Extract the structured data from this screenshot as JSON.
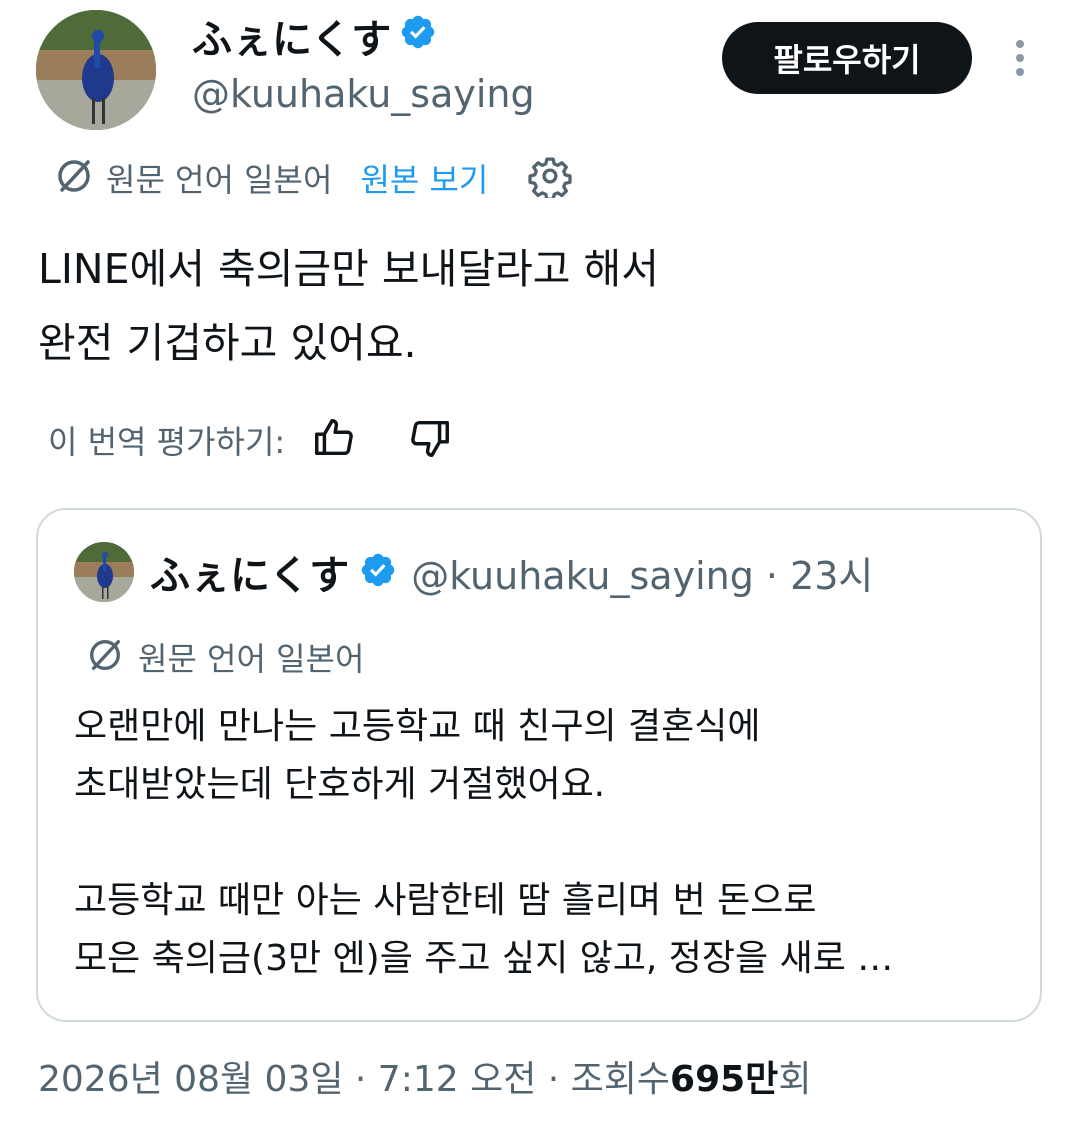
{
  "author": {
    "display_name": "ふぇにくす",
    "handle": "@kuuhaku_saying",
    "verified": true
  },
  "follow_button_label": "팔로우하기",
  "translation": {
    "source_label": "원문 언어 일본어",
    "view_original_label": "원본 보기"
  },
  "tweet_text_lines": [
    "LINE에서 축의금만 보내달라고 해서",
    "완전 기겁하고 있어요."
  ],
  "rate_translation_label": "이 번역 평가하기:",
  "quoted_tweet": {
    "display_name": "ふぇにくす",
    "handle_time": "@kuuhaku_saying · 23시",
    "translation_label": "원문 언어 일본어",
    "text_lines": [
      "오랜만에 만나는 고등학교 때 친구의 결혼식에",
      "초대받았는데 단호하게 거절했어요.",
      "",
      "고등학교 때만 아는 사람한테 땀 흘리며 번 돈으로",
      "모은 축의금(3만 엔)을 주고 싶지 않고, 정장을 새로 …"
    ]
  },
  "meta": {
    "date_time": "2026년 08월 03일 · 7:12 오전 · 조회수 ",
    "view_count": "695만",
    "view_suffix": "회"
  },
  "colors": {
    "text": "#0f1419",
    "secondary": "#536471",
    "link": "#1d9bf0",
    "border": "#cfd9de",
    "verified": "#1d9bf0"
  }
}
